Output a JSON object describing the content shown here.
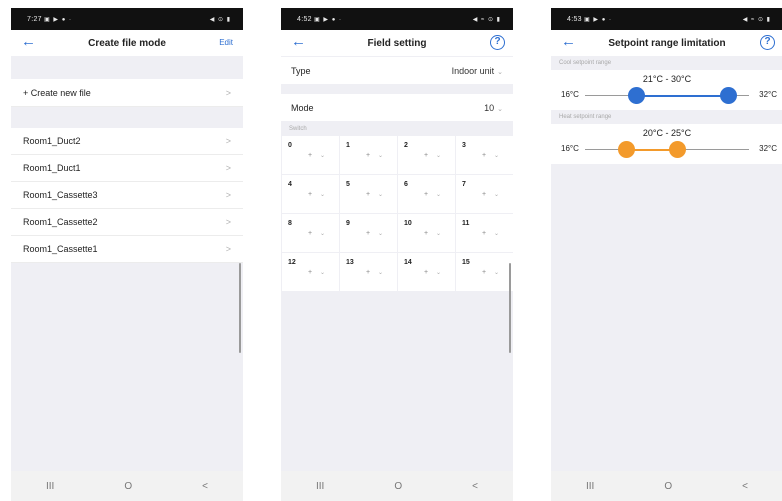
{
  "screens": [
    {
      "status_time": "7:27",
      "status_icons": "▣ ▶ ● ·",
      "status_right": "◀ ⊙ ▮",
      "title": "Create file mode",
      "right_action": "Edit",
      "create_item": "+ Create new file",
      "files": [
        "Room1_Duct2",
        "Room1_Duct1",
        "Room1_Cassette3",
        "Room1_Cassette2",
        "Room1_Cassette1"
      ],
      "nav": [
        "III",
        "O",
        "<"
      ]
    },
    {
      "status_time": "4:52",
      "status_icons": "▣ ▶ ● ·",
      "status_right": "◀ ≈ ⊙ ▮",
      "title": "Field setting",
      "type_label": "Type",
      "type_value": "Indoor unit",
      "mode_label": "Mode",
      "mode_value": "10",
      "switch_label": "Switch",
      "switches": [
        "0",
        "1",
        "2",
        "3",
        "4",
        "5",
        "6",
        "7",
        "8",
        "9",
        "10",
        "11",
        "12",
        "13",
        "14",
        "15"
      ],
      "switch_placeholder": "+",
      "nav": [
        "III",
        "O",
        "<"
      ]
    },
    {
      "status_time": "4:53",
      "status_icons": "▣ ▶ ● ·",
      "status_right": "◀ ≈ ⊙ ▮",
      "title": "Setpoint range limitation",
      "cool": {
        "label": "Cool setpoint range",
        "range_text": "21°C - 30°C",
        "min_label": "16°C",
        "max_label": "32°C",
        "scale_min": 16,
        "scale_max": 32,
        "low": 21,
        "high": 30,
        "color": "#2e6fd1"
      },
      "heat": {
        "label": "Heat setpoint range",
        "range_text": "20°C - 25°C",
        "min_label": "16°C",
        "max_label": "32°C",
        "scale_min": 16,
        "scale_max": 32,
        "low": 20,
        "high": 25,
        "color": "#f39a2b"
      },
      "nav": [
        "III",
        "O",
        "<"
      ]
    }
  ],
  "colors": {
    "accent": "#2e6fd1",
    "heat": "#f39a2b",
    "background": "#efeff4"
  }
}
